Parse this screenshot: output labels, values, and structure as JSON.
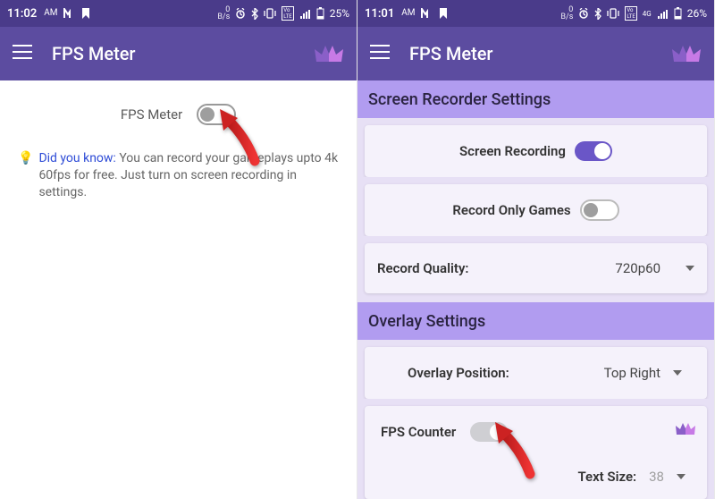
{
  "colors": {
    "statusbar": "#4a3b8a",
    "appbar": "#5c4ca0",
    "section": "#b19cf0",
    "card": "#f5f2fb",
    "switch_on": "#6a56c7"
  },
  "left": {
    "status": {
      "time": "11:02",
      "ampm": "AM",
      "battery": "25%",
      "net_badges": [
        "VoLTE"
      ],
      "net_speed": {
        "top": "0",
        "bottom": "B/s"
      }
    },
    "app_title": "FPS Meter",
    "master": {
      "label": "FPS Meter",
      "state": false
    },
    "tip": {
      "label": "Did you know:",
      "text": "You can record your gameplays upto 4k 60fps for free. Just turn on screen recording in settings."
    }
  },
  "right": {
    "status": {
      "time": "11:01",
      "ampm": "AM",
      "battery": "26%",
      "net_badges": [
        "VoLTE"
      ],
      "net_speed": {
        "top": "0",
        "bottom": "B/s"
      }
    },
    "app_title": "FPS Meter",
    "section_recorder": "Screen Recorder Settings",
    "rec_toggle": {
      "label": "Screen Recording",
      "state": true
    },
    "games_only": {
      "label": "Record Only Games",
      "state": false
    },
    "quality": {
      "label": "Record Quality:",
      "value": "720p60"
    },
    "section_overlay": "Overlay Settings",
    "overlay_pos": {
      "label": "Overlay Position:",
      "value": "Top Right"
    },
    "fps_counter": {
      "label": "FPS Counter",
      "state": true
    },
    "text_size": {
      "label": "Text Size:",
      "value": "38"
    }
  }
}
